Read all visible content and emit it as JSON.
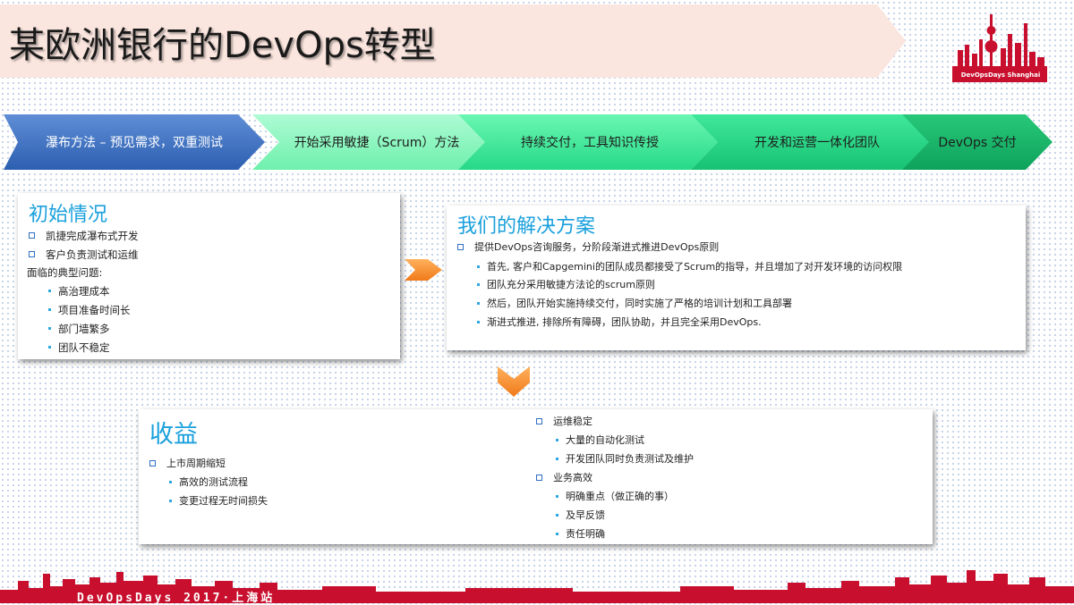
{
  "title": "某欧洲银行的DevOps转型",
  "logo": {
    "text": "DevOpsDays Shanghai",
    "icon": "shanghai-skyline-logo"
  },
  "colors": {
    "accent": "#1aa0dc",
    "orange": "#f28a2b",
    "brand_red": "#c8102e"
  },
  "stages": [
    {
      "label": "瀑布方法 – 预见需求，双重测试"
    },
    {
      "label": "开始采用敏捷（Scrum）方法"
    },
    {
      "label": "持续交付，工具知识传授"
    },
    {
      "label": "开发和运营一体化团队"
    },
    {
      "label": "DevOps 交付"
    }
  ],
  "initial": {
    "heading": "初始情况",
    "bullets": [
      "凯捷完成瀑布式开发",
      "客户负责测试和运维"
    ],
    "problems_label": "面临的典型问题:",
    "problems": [
      "高治理成本",
      "项目准备时间长",
      "部门墙繁多",
      "团队不稳定"
    ]
  },
  "solution": {
    "heading": "我们的解决方案",
    "bullet": "提供DevOps咨询服务，分阶段渐进式推进DevOps原则",
    "items": [
      "首先, 客户和Capgemini的团队成员都接受了Scrum的指导，并且增加了对开发环境的访问权限",
      "团队充分采用敏捷方法论的scrum原则",
      "然后，团队开始实施持续交付，同时实施了严格的培训计划和工具部署",
      "渐进式推进, 排除所有障碍，团队协助，并且完全采用DevOps."
    ]
  },
  "benefits": {
    "heading": "收益",
    "group1": {
      "label": "上市周期缩短",
      "items": [
        "高效的测试流程",
        "变更过程无时间损失"
      ]
    },
    "group2": {
      "label": "运维稳定",
      "items": [
        "大量的自动化测试",
        "开发团队同时负责测试及维护"
      ]
    },
    "group3": {
      "label": "业务高效",
      "items": [
        "明确重点（做正确的事）",
        "及早反馈",
        "责任明确"
      ]
    }
  },
  "footer": {
    "text": "DevOpsDays 2017·上海站"
  }
}
